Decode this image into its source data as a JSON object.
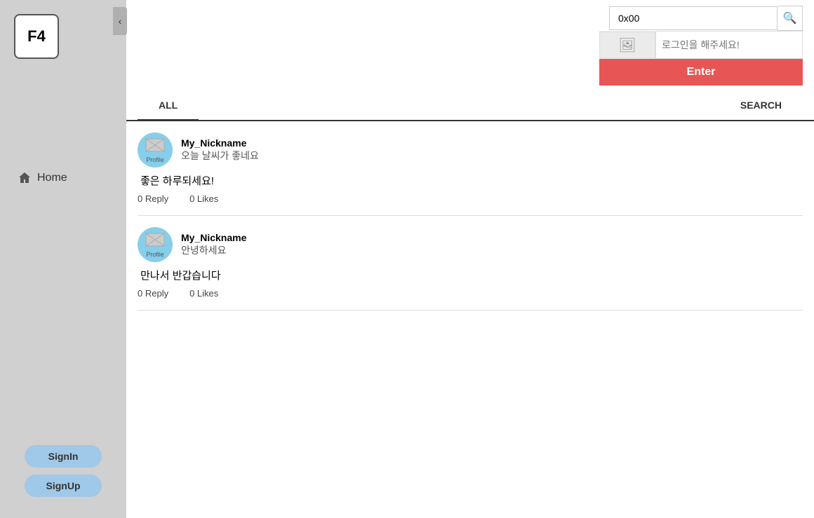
{
  "sidebar": {
    "f4_label": "F4",
    "home_label": "Home",
    "signin_label": "SignIn",
    "signup_label": "SignUp",
    "collapse_icon": "‹"
  },
  "header": {
    "search_value": "0x00",
    "search_placeholder": "0x00",
    "search_icon": "🔍",
    "image_icon": "🖼",
    "login_placeholder": "로그인을 해주세요!",
    "enter_label": "Enter"
  },
  "tabs": [
    {
      "id": "all",
      "label": "ALL",
      "active": true
    },
    {
      "id": "search",
      "label": "SEARCH",
      "active": false
    }
  ],
  "posts": [
    {
      "id": 1,
      "nickname": "My_Nickname",
      "summary": "오늘 날씨가 좋네요",
      "body": "좋은 하루되세요!",
      "reply_count": "0 Reply",
      "likes_count": "0 Likes",
      "avatar_label": "Profile"
    },
    {
      "id": 2,
      "nickname": "My_Nickname",
      "summary": "안녕하세요",
      "body": "만나서 반갑습니다",
      "reply_count": "0 Reply",
      "likes_count": "0 Likes",
      "avatar_label": "Profile"
    }
  ]
}
